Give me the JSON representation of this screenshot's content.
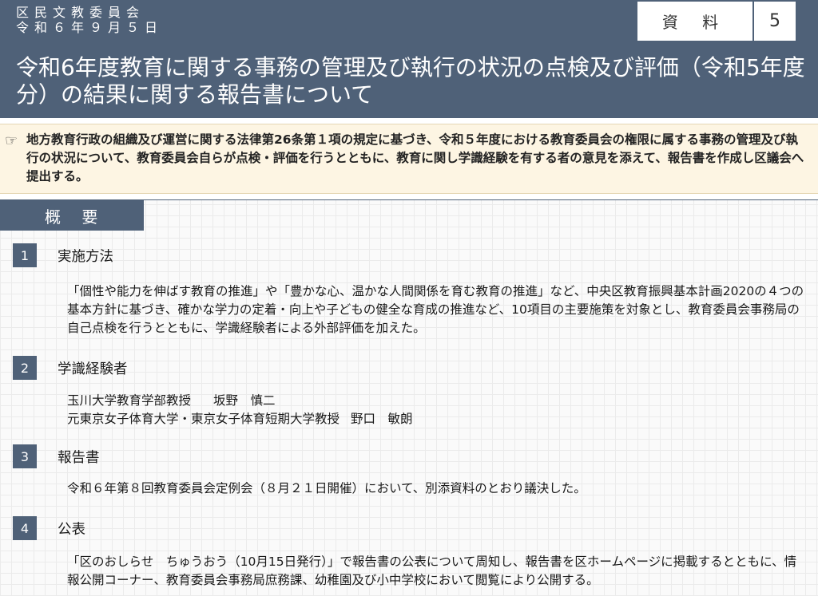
{
  "header": {
    "meeting_line1": "区民文教委員会",
    "meeting_line2": "令和６年９月５日",
    "doc_label": "資 料",
    "doc_number": "5",
    "title": "令和6年度教育に関する事務の管理及び執行の状況の点検及び評価（令和5年度分）の結果に関する報告書について"
  },
  "notice": {
    "icon": "pointing-hand-icon",
    "text": "地方教育行政の組織及び運営に関する法律第26条第１項の規定に基づき、令和５年度における教育委員会の権限に属する事務の管理及び執行の状況について、教育委員会自らが点検・評価を行うとともに、教育に関し学識経験を有する者の意見を添えて、報告書を作成し区議会へ提出する。"
  },
  "overview_label": "概 要",
  "sections": [
    {
      "number": "1",
      "title": "実施方法",
      "body": "「個性や能力を伸ばす教育の推進」や「豊かな心、温かな人間関係を育む教育の推進」など、中央区教育振興基本計画2020の４つの基本方針に基づき、確かな学力の定着・向上や子どもの健全な育成の推進など、10項目の主要施策を対象とし、教育委員会事務局の自己点検を行うとともに、学識経験者による外部評価を加えた。"
    },
    {
      "number": "2",
      "title": "学識経験者",
      "experts": [
        {
          "affiliation": "玉川大学教育学部教授",
          "name": "坂野　慎二"
        },
        {
          "affiliation": "元東京女子体育大学・東京女子体育短期大学教授",
          "name": "野口　敏朗"
        }
      ]
    },
    {
      "number": "3",
      "title": "報告書",
      "body": "令和６年第８回教育委員会定例会（８月２１日開催）において、別添資料のとおり議決した。"
    },
    {
      "number": "4",
      "title": "公表",
      "body": "「区のおしらせ　ちゅうおう（10月15日発行）」で報告書の公表について周知し、報告書を区ホームページに掲載するとともに、情報公開コーナー、教育委員会事務局庶務課、幼稚園及び小中学校において閲覧により公開する。"
    }
  ]
}
